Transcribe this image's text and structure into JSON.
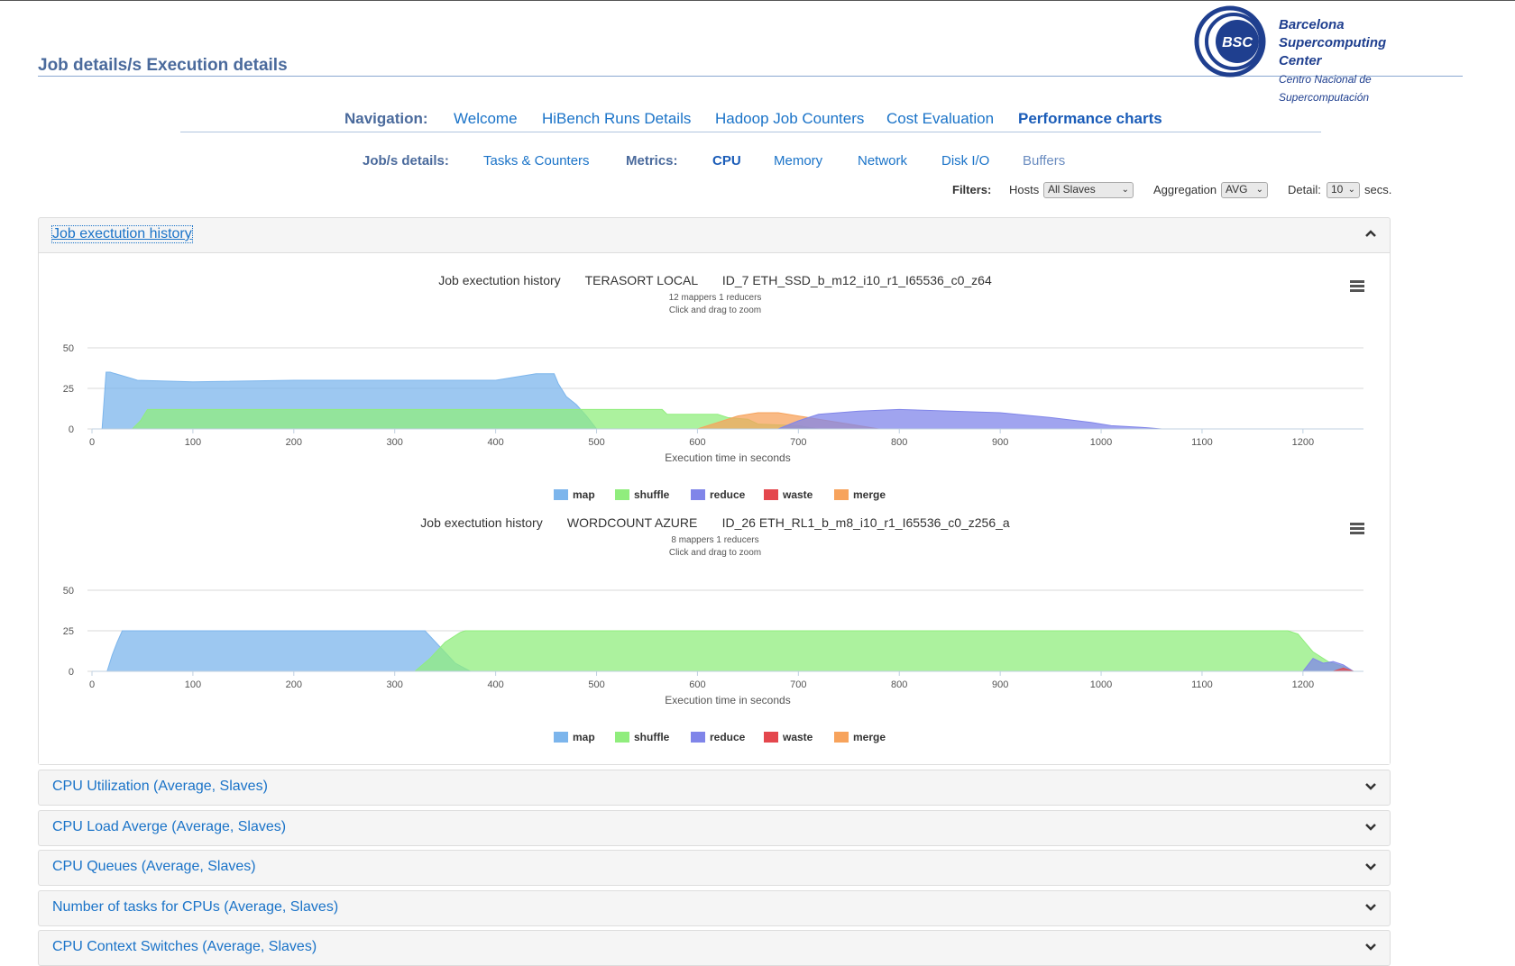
{
  "header": {
    "title": "Job details/s Execution details",
    "logo": {
      "line1": "Barcelona",
      "line2": "Supercomputing",
      "line3": "Center",
      "sub": "Centro Nacional de Supercomputación",
      "mark": "BSC"
    }
  },
  "nav": {
    "label": "Navigation:",
    "items": [
      "Welcome",
      "HiBench Runs Details",
      "Hadoop Job Counters",
      "Cost Evaluation",
      "Performance charts"
    ]
  },
  "subnav": {
    "jobs_label": "Job/s details:",
    "tasks_link": "Tasks & Counters",
    "metrics_label": "Metrics:",
    "metrics": [
      "CPU",
      "Memory",
      "Network",
      "Disk I/O",
      "Buffers"
    ]
  },
  "filters": {
    "label": "Filters:",
    "hosts_label": "Hosts",
    "hosts_value": "All Slaves",
    "aggregation_label": "Aggregation",
    "aggregation_value": "AVG",
    "detail_label": "Detail:",
    "detail_value": "10",
    "detail_unit": "secs."
  },
  "panels": {
    "job_history": "Job exectution history",
    "collapsed": [
      "CPU Utilization (Average, Slaves)",
      "CPU Load Averge (Average, Slaves)",
      "CPU Queues (Average, Slaves)",
      "Number of tasks for CPUs (Average, Slaves)",
      "CPU Context Switches (Average, Slaves)"
    ]
  },
  "colors": {
    "map": "#7cb5ec",
    "shuffle": "#90ed7d",
    "reduce": "#8085e9",
    "waste": "#e4474d",
    "merge": "#f7a35c"
  },
  "chart_data": [
    {
      "type": "area",
      "title": "Job exectution history",
      "benchmark": "TERASORT LOCAL",
      "run_id": "ID_7 ETH_SSD_b_m12_i10_r1_I65536_c0_z64",
      "subtitle": "12 mappers 1 reducers",
      "hint": "Click and drag to zoom",
      "xlabel": "Execution time in seconds",
      "xlim": [
        0,
        1260
      ],
      "ylim": [
        0,
        50
      ],
      "yticks": [
        0,
        25,
        50
      ],
      "xticks": [
        0,
        100,
        200,
        300,
        400,
        500,
        600,
        700,
        800,
        900,
        1000,
        1100,
        1200
      ],
      "legend": [
        "map",
        "shuffle",
        "reduce",
        "waste",
        "merge"
      ],
      "series": [
        {
          "name": "map",
          "x": [
            0,
            10,
            14,
            18,
            40,
            45,
            100,
            200,
            300,
            400,
            440,
            458,
            462,
            470,
            480,
            490,
            500
          ],
          "y": [
            0,
            0,
            35,
            35,
            31,
            30,
            29,
            30,
            30,
            30,
            34,
            34,
            28,
            20,
            15,
            8,
            0
          ]
        },
        {
          "name": "shuffle",
          "x": [
            0,
            40,
            48,
            55,
            460,
            480,
            490,
            565,
            570,
            620,
            630,
            650,
            660,
            700,
            710,
            720
          ],
          "y": [
            0,
            0,
            5,
            12,
            12,
            12,
            12,
            12,
            9,
            9,
            7,
            6,
            3,
            2,
            1,
            0
          ]
        },
        {
          "name": "merge",
          "x": [
            600,
            620,
            640,
            660,
            680,
            700,
            720,
            740,
            760,
            780
          ],
          "y": [
            0,
            4,
            8,
            10,
            10,
            8,
            6,
            4,
            2,
            0
          ]
        },
        {
          "name": "reduce",
          "x": [
            680,
            700,
            720,
            740,
            760,
            800,
            900,
            950,
            990,
            1010,
            1040,
            1060
          ],
          "y": [
            0,
            5,
            9,
            10,
            11,
            12,
            10,
            7,
            4,
            2,
            1,
            0
          ]
        },
        {
          "name": "waste",
          "x": [
            0,
            1260
          ],
          "y": [
            0,
            0
          ]
        }
      ]
    },
    {
      "type": "area",
      "title": "Job exectution history",
      "benchmark": "WORDCOUNT AZURE",
      "run_id": "ID_26 ETH_RL1_b_m8_i10_r1_I65536_c0_z256_a",
      "subtitle": "8 mappers 1 reducers",
      "hint": "Click and drag to zoom",
      "xlabel": "Execution time in seconds",
      "xlim": [
        0,
        1260
      ],
      "ylim": [
        0,
        50
      ],
      "yticks": [
        0,
        25,
        50
      ],
      "xticks": [
        0,
        100,
        200,
        300,
        400,
        500,
        600,
        700,
        800,
        900,
        1000,
        1100,
        1200
      ],
      "legend": [
        "map",
        "shuffle",
        "reduce",
        "waste",
        "merge"
      ],
      "series": [
        {
          "name": "map",
          "x": [
            0,
            15,
            20,
            25,
            30,
            330,
            345,
            360,
            375
          ],
          "y": [
            0,
            0,
            10,
            18,
            25,
            25,
            15,
            5,
            0
          ]
        },
        {
          "name": "shuffle",
          "x": [
            320,
            335,
            350,
            365,
            370,
            1185,
            1195,
            1210,
            1225,
            1240,
            1250
          ],
          "y": [
            0,
            8,
            18,
            24,
            25,
            25,
            23,
            12,
            6,
            3,
            0
          ]
        },
        {
          "name": "reduce",
          "x": [
            1200,
            1210,
            1220,
            1230,
            1240,
            1250
          ],
          "y": [
            0,
            8,
            5,
            6,
            4,
            0
          ]
        },
        {
          "name": "merge",
          "x": [
            0,
            1260
          ],
          "y": [
            0,
            0
          ]
        },
        {
          "name": "waste",
          "x": [
            1230,
            1240,
            1250
          ],
          "y": [
            0,
            2,
            0
          ]
        }
      ]
    }
  ]
}
